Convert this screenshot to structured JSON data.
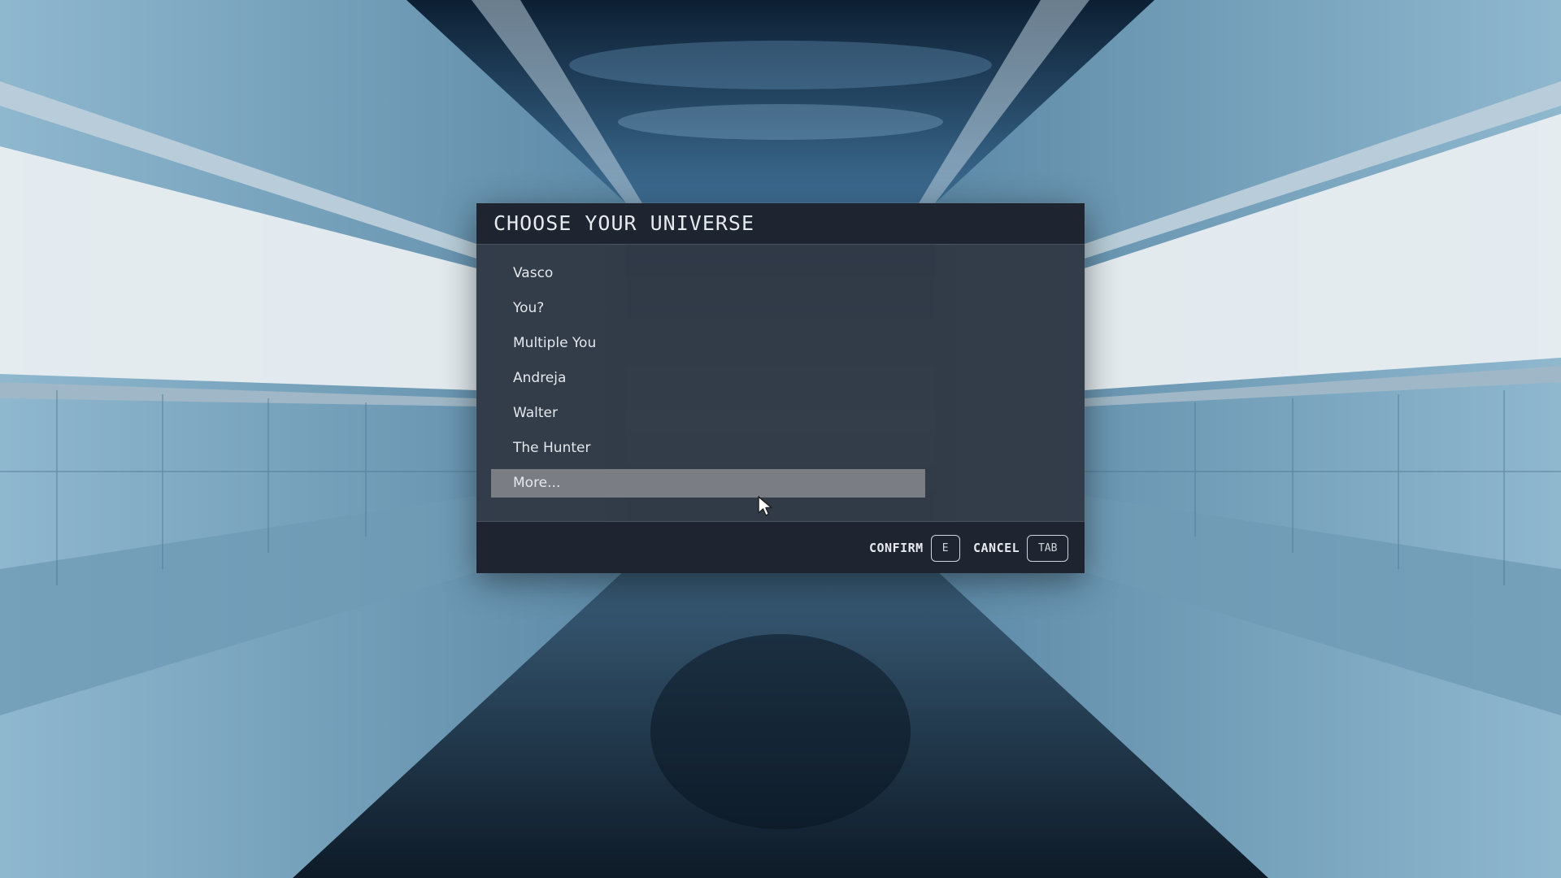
{
  "dialog": {
    "title": "CHOOSE YOUR UNIVERSE",
    "options": [
      {
        "label": "Vasco",
        "selected": false
      },
      {
        "label": "You?",
        "selected": false
      },
      {
        "label": "Multiple You",
        "selected": false
      },
      {
        "label": "Andreja",
        "selected": false
      },
      {
        "label": "Walter",
        "selected": false
      },
      {
        "label": "The Hunter",
        "selected": false
      },
      {
        "label": "More...",
        "selected": true
      }
    ],
    "footer": {
      "confirm_label": "CONFIRM",
      "confirm_key": "E",
      "cancel_label": "CANCEL",
      "cancel_key": "TAB"
    }
  },
  "colors": {
    "panel": "#2f3642",
    "header": "#1e2531",
    "selected_row": "#7a7e84",
    "text": "#e6e9ed"
  },
  "icons": {
    "cursor": "mouse-pointer-icon"
  }
}
